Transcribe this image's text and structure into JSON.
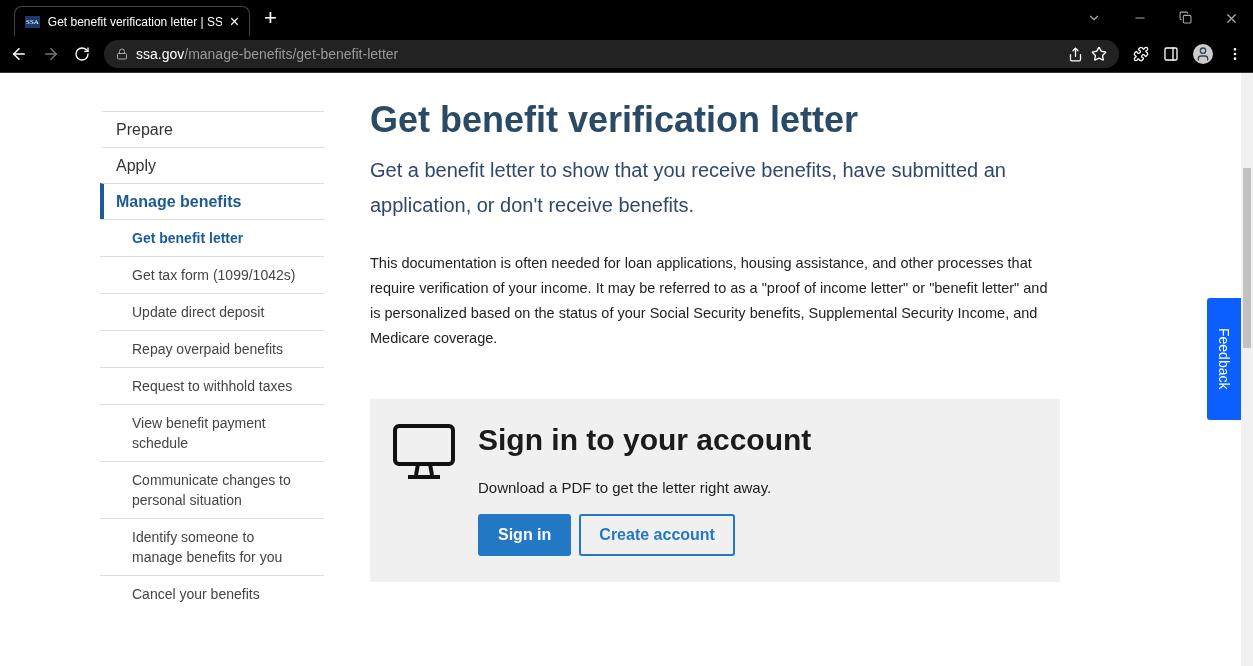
{
  "browser": {
    "tab": {
      "favicon": "SSA",
      "title": "Get benefit verification letter | SS",
      "close": "×"
    },
    "new_tab": "+",
    "url": {
      "domain": "ssa.gov",
      "path": "/manage-benefits/get-benefit-letter"
    }
  },
  "sidebar": {
    "items": [
      {
        "label": "Prepare",
        "selected": false
      },
      {
        "label": "Apply",
        "selected": false
      },
      {
        "label": "Manage benefits",
        "selected": true,
        "children": [
          {
            "label": "Get benefit letter",
            "selected": true
          },
          {
            "label": "Get tax form (1099/1042s)",
            "selected": false
          },
          {
            "label": "Update direct deposit",
            "selected": false
          },
          {
            "label": "Repay overpaid benefits",
            "selected": false
          },
          {
            "label": "Request to withhold taxes",
            "selected": false
          },
          {
            "label": "View benefit payment schedule",
            "selected": false
          },
          {
            "label": "Communicate changes to personal situation",
            "selected": false
          },
          {
            "label": "Identify someone to manage benefits for you",
            "selected": false
          },
          {
            "label": "Cancel your benefits",
            "selected": false
          }
        ]
      }
    ]
  },
  "main": {
    "title": "Get benefit verification letter",
    "lead": "Get a benefit letter to show that you receive benefits, have submitted an application, or don't receive benefits.",
    "body": "This documentation is often needed for loan applications, housing assistance, and other processes that require verification of your income. It may be referred to as a \"proof of income letter\" or \"benefit letter\" and is personalized based on the status of your Social Security benefits, Supplemental Security Income, and Medicare coverage.",
    "card": {
      "title": "Sign in to your account",
      "text": "Download a PDF to get the letter right away.",
      "buttons": [
        {
          "label": "Sign in",
          "kind": "primary"
        },
        {
          "label": "Create account",
          "kind": "outline"
        }
      ]
    }
  },
  "feedback": "Feedback"
}
